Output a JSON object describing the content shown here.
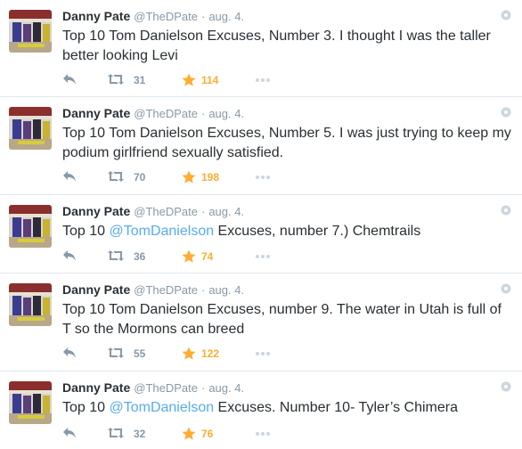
{
  "colors": {
    "accent": "#55acee",
    "muted": "#8899a6",
    "favorite": "#ffac33",
    "text": "#292f33"
  },
  "tweets": [
    {
      "name": "Danny Pate",
      "handle": "@TheDPate",
      "dot": "·",
      "date": "aug. 4.",
      "text_before": "Top 10 Tom Danielson Excuses, Number 3. I thought I was the taller better looking Levi",
      "mention": "",
      "text_after": "",
      "retweets": "31",
      "favorites": "114"
    },
    {
      "name": "Danny Pate",
      "handle": "@TheDPate",
      "dot": "·",
      "date": "aug. 4.",
      "text_before": "Top 10 Tom Danielson Excuses, Number 5. I was just trying to keep my podium girlfriend sexually satisfied.",
      "mention": "",
      "text_after": "",
      "retweets": "70",
      "favorites": "198"
    },
    {
      "name": "Danny Pate",
      "handle": "@TheDPate",
      "dot": "·",
      "date": "aug. 4.",
      "text_before": "Top 10 ",
      "mention": "@TomDanielson",
      "text_after": " Excuses, number 7.) Chemtrails",
      "retweets": "36",
      "favorites": "74"
    },
    {
      "name": "Danny Pate",
      "handle": "@TheDPate",
      "dot": "·",
      "date": "aug. 4.",
      "text_before": "Top 10 Tom Danielson Excuses, number 9. The water in Utah is full of T so the Mormons can breed",
      "mention": "",
      "text_after": "",
      "retweets": "55",
      "favorites": "122"
    },
    {
      "name": "Danny Pate",
      "handle": "@TheDPate",
      "dot": "·",
      "date": "aug. 4.",
      "text_before": "Top 10 ",
      "mention": "@TomDanielson",
      "text_after": " Excuses. Number 10- Tyler’s Chimera",
      "retweets": "32",
      "favorites": "76"
    }
  ]
}
